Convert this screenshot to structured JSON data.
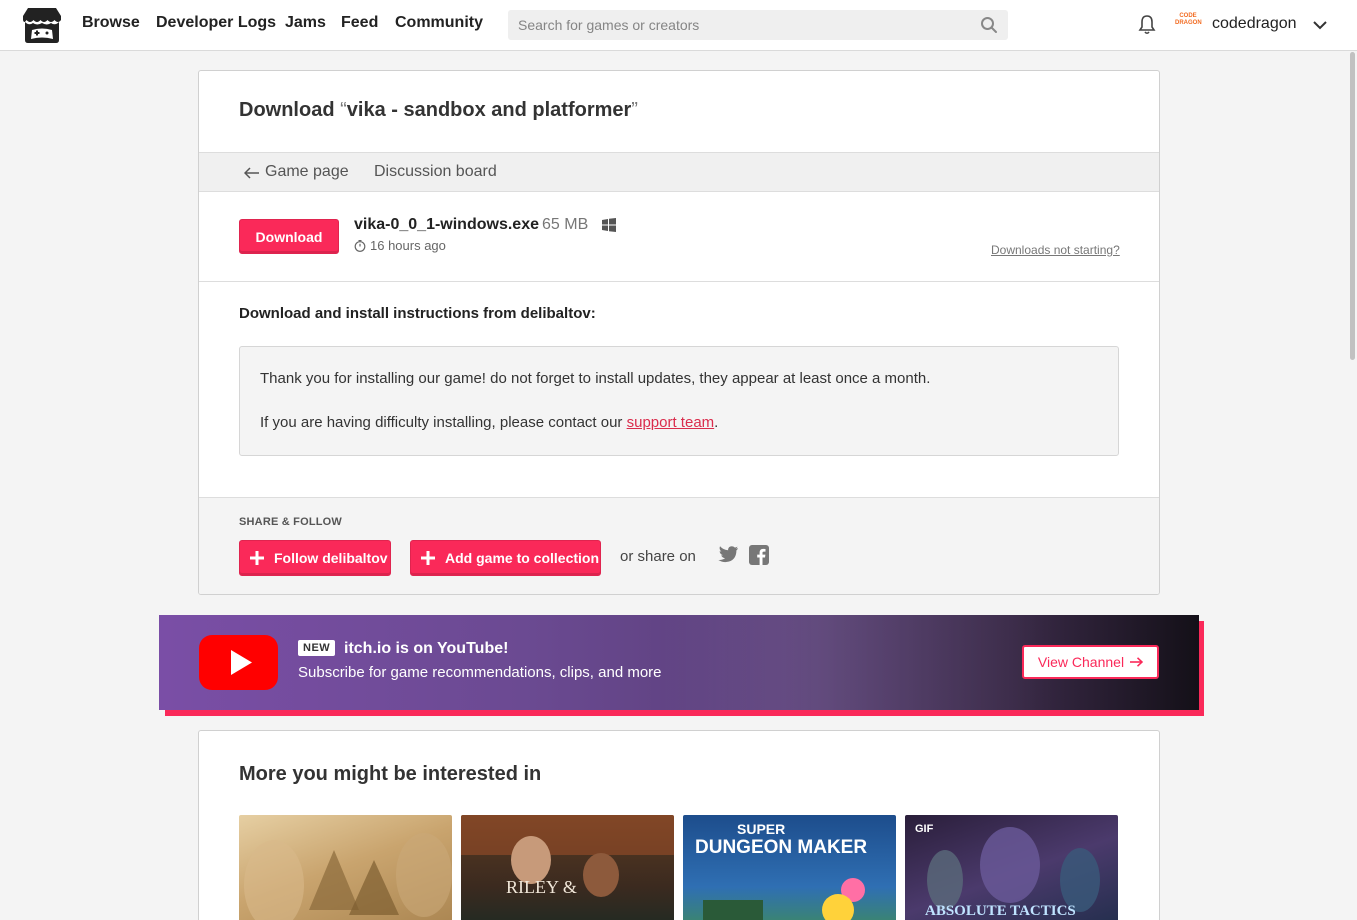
{
  "header": {
    "nav": [
      "Browse",
      "Developer Logs",
      "Jams",
      "Feed",
      "Community"
    ],
    "search_placeholder": "Search for games or creators",
    "avatar_text": "CODE DRAGON",
    "username": "codedragon"
  },
  "card": {
    "title_prefix": "Download ",
    "open_quote": "“",
    "game_name": "vika - sandbox and platformer",
    "close_quote": "”",
    "game_page_link": "Game page",
    "discussion_link": "Discussion board",
    "download_label": "Download",
    "filename": "vika-0_0_1-windows.exe",
    "filesize": "65 MB",
    "uploaded": "16 hours ago",
    "not_starting": "Downloads not starting?",
    "instructions_title": "Download and install instructions from delibaltov:",
    "instructions_line1": "Thank you for installing our game! do not forget to install updates, they appear at least once a month.",
    "instructions_line2_prefix": "If you are having difficulty installing, please contact our ",
    "support_link": "support team",
    "instructions_line2_suffix": ".",
    "share_label": "SHARE & FOLLOW",
    "follow_label": "Follow delibaltov",
    "collection_label": "Add game to collection",
    "or_share": "or share on"
  },
  "banner": {
    "new_tag": "NEW",
    "title": "itch.io is on YouTube!",
    "subtitle": "Subscribe for game recommendations, clips, and more",
    "button": "View Channel"
  },
  "more": {
    "title": "More you might be interested in",
    "thumbs": [
      {
        "name": "autumn-forest-game",
        "label": ""
      },
      {
        "name": "riley-game",
        "label": "RILEY &"
      },
      {
        "name": "super-dungeon-maker",
        "label_top": "SUPER",
        "label_main": "DUNGEON MAKER"
      },
      {
        "name": "absolute-tactics",
        "gif": "GIF",
        "label": "ABSOLUTE TACTICS"
      }
    ]
  }
}
